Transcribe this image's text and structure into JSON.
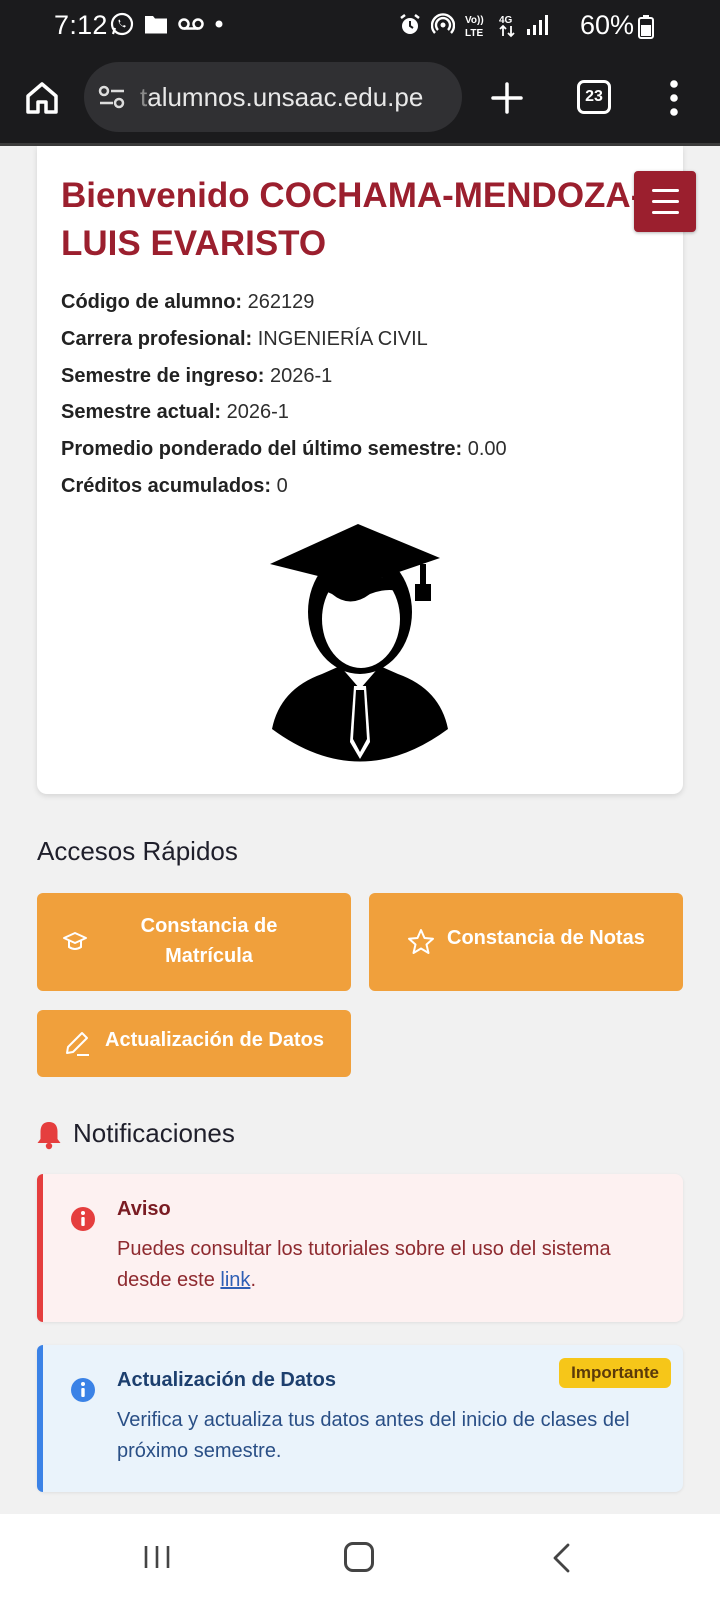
{
  "status_bar": {
    "time": "7:12",
    "battery": "60%",
    "network": "4G"
  },
  "browser": {
    "url_dim": "t",
    "url_main": "alumnos.unsaac.edu.pe",
    "tab_count": "23"
  },
  "profile": {
    "welcome": "Bienvenido COCHAMA-MENDOZA-LUIS EVARISTO",
    "fields": [
      {
        "label": "Código de alumno:",
        "value": "262129"
      },
      {
        "label": "Carrera profesional:",
        "value": "INGENIERÍA CIVIL"
      },
      {
        "label": "Semestre de ingreso:",
        "value": "2026-1"
      },
      {
        "label": "Semestre actual:",
        "value": "2026-1"
      },
      {
        "label": "Promedio ponderado del último semestre:",
        "value": "0.00"
      },
      {
        "label": "Créditos acumulados:",
        "value": "0"
      }
    ]
  },
  "quick_access": {
    "title": "Accesos Rápidos",
    "buttons": [
      {
        "label": "Constancia de Matrícula",
        "icon": "graduation-cap-icon"
      },
      {
        "label": "Constancia de Notas",
        "icon": "star-icon"
      },
      {
        "label": "Actualización de Datos",
        "icon": "pencil-icon"
      }
    ]
  },
  "notifications": {
    "title": "Notificaciones",
    "items": [
      {
        "title": "Aviso",
        "text_before": "Puedes consultar los tutoriales sobre el uso del sistema desde este ",
        "link": "link",
        "text_after": ".",
        "color": "#e53e3e"
      },
      {
        "title": "Actualización de Datos",
        "badge": "Importante",
        "text": "Verifica y actualiza tus datos antes del inicio de clases del próximo semestre.",
        "color": "#3b82e6"
      }
    ]
  },
  "colors": {
    "brand": "#9b1f2e",
    "accent": "#f0a03c"
  }
}
